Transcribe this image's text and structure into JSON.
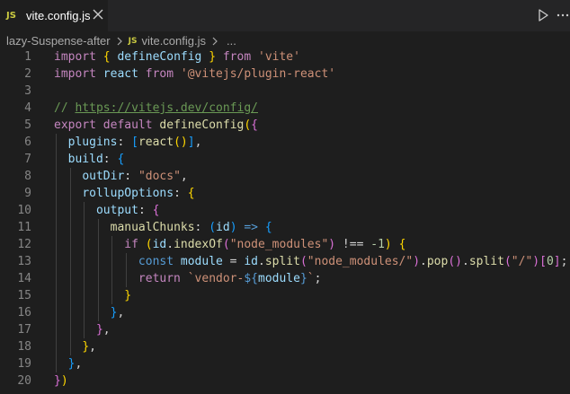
{
  "tab": {
    "icon_text": "JS",
    "label": "vite.config.js"
  },
  "toolbar": {
    "run_icon": "play-icon",
    "more_icon": "more-actions-icon"
  },
  "breadcrumb": {
    "folder": "lazy-Suspense-after",
    "icon_text": "JS",
    "file": "vite.config.js",
    "ellipsis": "..."
  },
  "colors": {
    "keyword": "#c586c0",
    "identifier": "#9cdcfe",
    "function": "#dcdcaa",
    "string": "#ce9178",
    "comment": "#6a9955",
    "number": "#b5cea8",
    "bracket_1": "#ffd700",
    "bracket_2": "#da70d6",
    "bracket_3": "#179fff"
  },
  "lines": [
    {
      "n": "1",
      "tokens": [
        [
          "kw",
          "import"
        ],
        [
          "p",
          " "
        ],
        [
          "br1",
          "{"
        ],
        [
          "p",
          " "
        ],
        [
          "id",
          "defineConfig"
        ],
        [
          "p",
          " "
        ],
        [
          "br1",
          "}"
        ],
        [
          "p",
          " "
        ],
        [
          "kw",
          "from"
        ],
        [
          "p",
          " "
        ],
        [
          "str",
          "'vite'"
        ]
      ]
    },
    {
      "n": "2",
      "tokens": [
        [
          "kw",
          "import"
        ],
        [
          "p",
          " "
        ],
        [
          "id",
          "react"
        ],
        [
          "p",
          " "
        ],
        [
          "kw",
          "from"
        ],
        [
          "p",
          " "
        ],
        [
          "str",
          "'@vitejs/plugin-react'"
        ]
      ]
    },
    {
      "n": "3",
      "tokens": []
    },
    {
      "n": "4",
      "tokens": [
        [
          "cm",
          "// "
        ],
        [
          "cm link",
          "https://vitejs.dev/config/"
        ]
      ]
    },
    {
      "n": "5",
      "tokens": [
        [
          "kw",
          "export"
        ],
        [
          "p",
          " "
        ],
        [
          "kw",
          "default"
        ],
        [
          "p",
          " "
        ],
        [
          "fn",
          "defineConfig"
        ],
        [
          "br1",
          "("
        ],
        [
          "br2",
          "{"
        ]
      ]
    },
    {
      "n": "6",
      "tokens": [
        [
          "p",
          "  "
        ],
        [
          "id",
          "plugins"
        ],
        [
          "p",
          ": "
        ],
        [
          "br3",
          "["
        ],
        [
          "fn",
          "react"
        ],
        [
          "br1",
          "()"
        ],
        [
          "br3",
          "]"
        ],
        [
          "p",
          ","
        ]
      ]
    },
    {
      "n": "7",
      "tokens": [
        [
          "p",
          "  "
        ],
        [
          "id",
          "build"
        ],
        [
          "p",
          ": "
        ],
        [
          "br3",
          "{"
        ]
      ]
    },
    {
      "n": "8",
      "tokens": [
        [
          "p",
          "    "
        ],
        [
          "id",
          "outDir"
        ],
        [
          "p",
          ": "
        ],
        [
          "str",
          "\"docs\""
        ],
        [
          "p",
          ","
        ]
      ]
    },
    {
      "n": "9",
      "tokens": [
        [
          "p",
          "    "
        ],
        [
          "id",
          "rollupOptions"
        ],
        [
          "p",
          ": "
        ],
        [
          "br1",
          "{"
        ]
      ]
    },
    {
      "n": "10",
      "tokens": [
        [
          "p",
          "      "
        ],
        [
          "id",
          "output"
        ],
        [
          "p",
          ": "
        ],
        [
          "br2",
          "{"
        ]
      ]
    },
    {
      "n": "11",
      "tokens": [
        [
          "p",
          "        "
        ],
        [
          "fn",
          "manualChunks"
        ],
        [
          "p",
          ": "
        ],
        [
          "br3",
          "("
        ],
        [
          "id",
          "id"
        ],
        [
          "br3",
          ")"
        ],
        [
          "p",
          " "
        ],
        [
          "st",
          "=>"
        ],
        [
          "p",
          " "
        ],
        [
          "br3",
          "{"
        ]
      ]
    },
    {
      "n": "12",
      "tokens": [
        [
          "p",
          "          "
        ],
        [
          "kw",
          "if"
        ],
        [
          "p",
          " "
        ],
        [
          "br1",
          "("
        ],
        [
          "id",
          "id"
        ],
        [
          "p",
          "."
        ],
        [
          "fn",
          "indexOf"
        ],
        [
          "br2",
          "("
        ],
        [
          "str",
          "\"node_modules\""
        ],
        [
          "br2",
          ")"
        ],
        [
          "p",
          " !== "
        ],
        [
          "num",
          "-1"
        ],
        [
          "br1",
          ")"
        ],
        [
          "p",
          " "
        ],
        [
          "br1",
          "{"
        ]
      ]
    },
    {
      "n": "13",
      "tokens": [
        [
          "p",
          "            "
        ],
        [
          "st",
          "const"
        ],
        [
          "p",
          " "
        ],
        [
          "id",
          "module"
        ],
        [
          "p",
          " = "
        ],
        [
          "id",
          "id"
        ],
        [
          "p",
          "."
        ],
        [
          "fn",
          "split"
        ],
        [
          "br2",
          "("
        ],
        [
          "str",
          "\"node_modules/\""
        ],
        [
          "br2",
          ")"
        ],
        [
          "p",
          "."
        ],
        [
          "fn",
          "pop"
        ],
        [
          "br2",
          "()"
        ],
        [
          "p",
          "."
        ],
        [
          "fn",
          "split"
        ],
        [
          "br2",
          "("
        ],
        [
          "str",
          "\"/\""
        ],
        [
          "br2",
          ")"
        ],
        [
          "br2",
          "["
        ],
        [
          "num",
          "0"
        ],
        [
          "br2",
          "]"
        ],
        [
          "p",
          ";"
        ]
      ]
    },
    {
      "n": "14",
      "tokens": [
        [
          "p",
          "            "
        ],
        [
          "kw",
          "return"
        ],
        [
          "p",
          " "
        ],
        [
          "str",
          "`vendor-"
        ],
        [
          "st",
          "${"
        ],
        [
          "id",
          "module"
        ],
        [
          "st",
          "}"
        ],
        [
          "str",
          "`"
        ],
        [
          "p",
          ";"
        ]
      ]
    },
    {
      "n": "15",
      "tokens": [
        [
          "p",
          "          "
        ],
        [
          "br1",
          "}"
        ]
      ]
    },
    {
      "n": "16",
      "tokens": [
        [
          "p",
          "        "
        ],
        [
          "br3",
          "}"
        ],
        [
          "p",
          ","
        ]
      ]
    },
    {
      "n": "17",
      "tokens": [
        [
          "p",
          "      "
        ],
        [
          "br2",
          "}"
        ],
        [
          "p",
          ","
        ]
      ]
    },
    {
      "n": "18",
      "tokens": [
        [
          "p",
          "    "
        ],
        [
          "br1",
          "}"
        ],
        [
          "p",
          ","
        ]
      ]
    },
    {
      "n": "19",
      "tokens": [
        [
          "p",
          "  "
        ],
        [
          "br3",
          "}"
        ],
        [
          "p",
          ","
        ]
      ]
    },
    {
      "n": "20",
      "tokens": [
        [
          "br2",
          "}"
        ],
        [
          "br1",
          ")"
        ]
      ]
    }
  ]
}
